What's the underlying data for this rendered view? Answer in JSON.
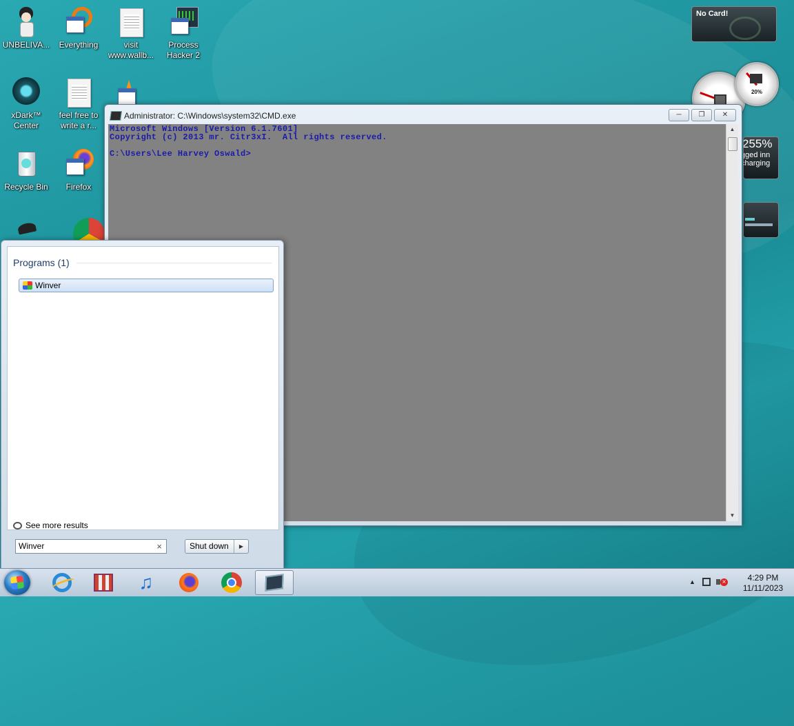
{
  "desktop": {
    "icons": [
      {
        "label": "UNBELIVA...",
        "icon": "anime-character-icon"
      },
      {
        "label": "Everything",
        "icon": "everything-search-icon"
      },
      {
        "label": "visit www.wallb...",
        "icon": "text-document-icon"
      },
      {
        "label": "Process Hacker 2",
        "icon": "process-hacker-icon"
      },
      {
        "label": "xDark™ Center",
        "icon": "xdark-center-icon"
      },
      {
        "label": "feel free to write a r...",
        "icon": "text-document-icon"
      },
      {
        "label": "Recycle Bin",
        "icon": "recycle-bin-icon"
      },
      {
        "label": "Firefox",
        "icon": "firefox-icon"
      }
    ]
  },
  "gadgets": {
    "gpu": {
      "label": "No Card!"
    },
    "meter": {
      "value": "20%"
    },
    "battery": {
      "percent": "255%",
      "line1": "gged inn",
      "line2": "charging"
    }
  },
  "cmd_window": {
    "title": "Administrator: C:\\Windows\\system32\\CMD.exe",
    "buttons": {
      "minimize": "─",
      "restore": "❐",
      "close": "✕"
    },
    "console_lines": [
      "Microsoft Windows [Version 6.1.7601]",
      "Copyright (c) 2013 mr. Citr3xI.  All rights reserved.",
      "",
      "C:\\Users\\Lee Harvey Oswald>"
    ]
  },
  "start_menu": {
    "section_header": "Programs (1)",
    "results": [
      {
        "label": "Winver"
      }
    ],
    "see_more": "See more results",
    "search_value": "Winver",
    "clear": "×",
    "shutdown_label": "Shut down",
    "shutdown_arrow": "▶"
  },
  "taskbar": {
    "items": [
      "internet-explorer-icon",
      "store-icon",
      "itunes-icon",
      "firefox-icon",
      "chrome-icon",
      "cmd-icon"
    ],
    "tray": {
      "time": "4:29 PM",
      "date": "11/11/2023",
      "show_hidden": "▲"
    }
  }
}
